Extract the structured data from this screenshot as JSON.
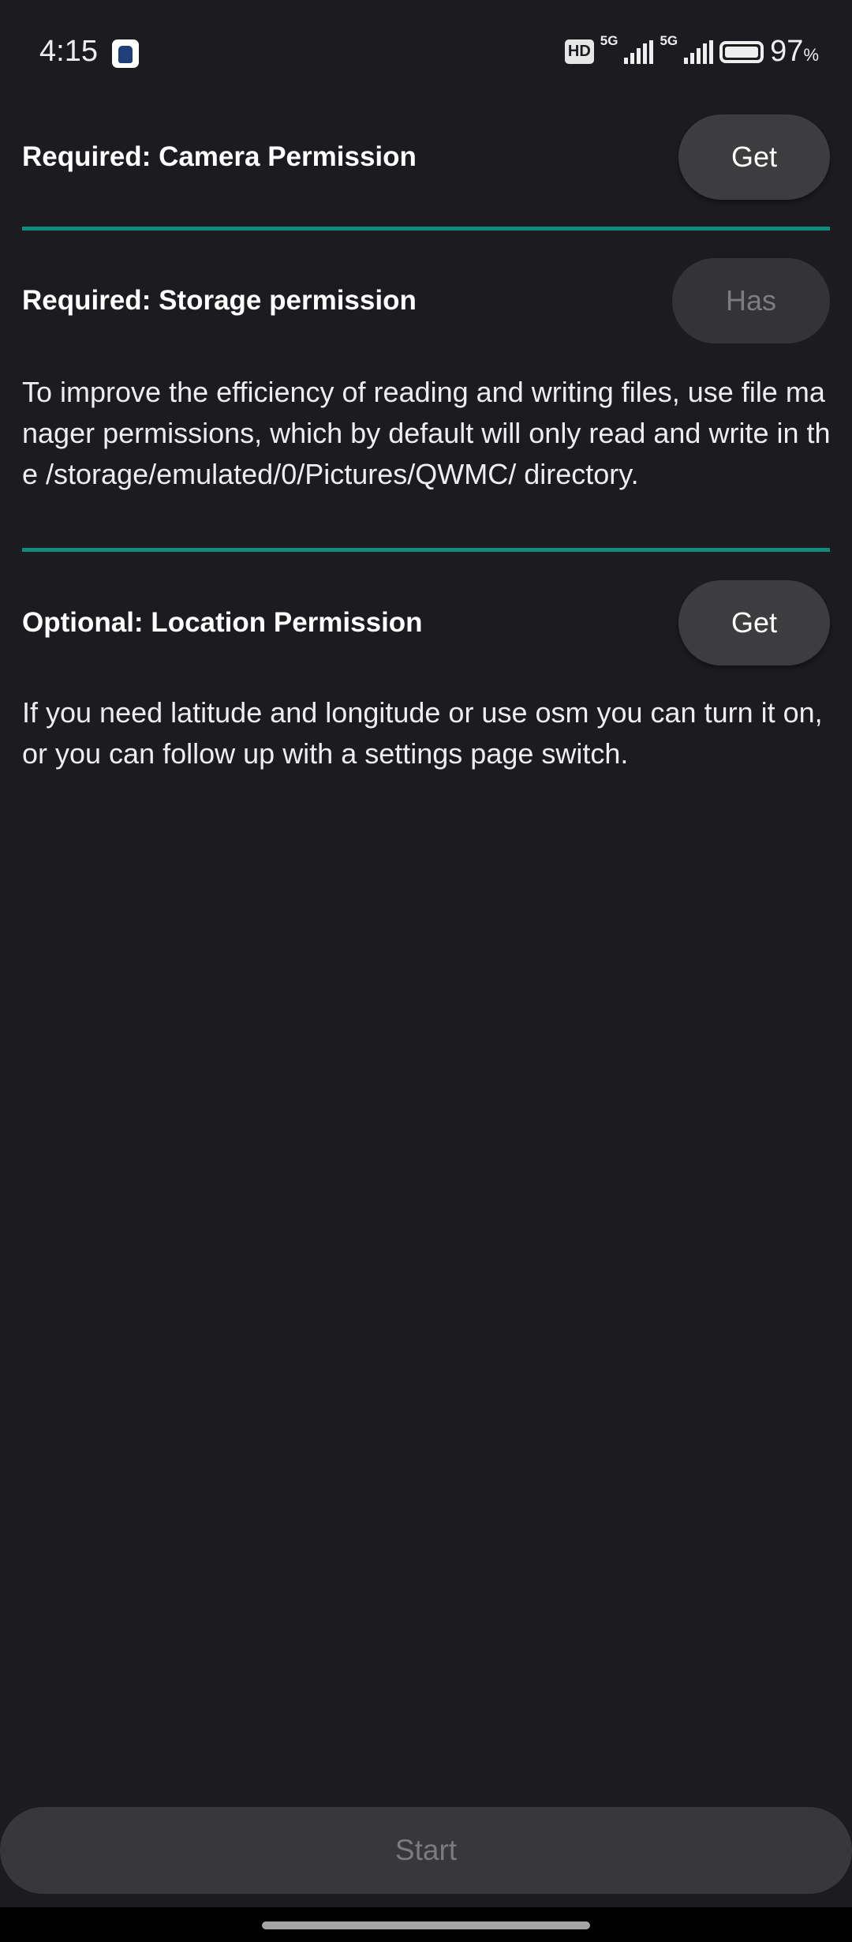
{
  "status_bar": {
    "time": "4:15",
    "hd_label": "HD",
    "network_1": "5G",
    "network_2": "5G",
    "battery_percent": "97",
    "percent_sign": "%"
  },
  "permissions": [
    {
      "label": "Required: Camera Permission",
      "button": "Get",
      "enabled": true
    },
    {
      "label": "Required: Storage permission",
      "button": "Has",
      "enabled": false,
      "description": "To improve the efficiency of reading and writing files, use file manager permissions, which by default will only read and write in the /storage/emulated/0/Pictures/QWMC/ directory."
    },
    {
      "label": "Optional: Location Permission",
      "button": "Get",
      "enabled": true,
      "description": "If you need latitude and longitude or use osm you can turn it on, or you can follow up with a settings page switch."
    }
  ],
  "divider_color": "#0f8c7e",
  "start_button": {
    "label": "Start",
    "enabled": false
  }
}
